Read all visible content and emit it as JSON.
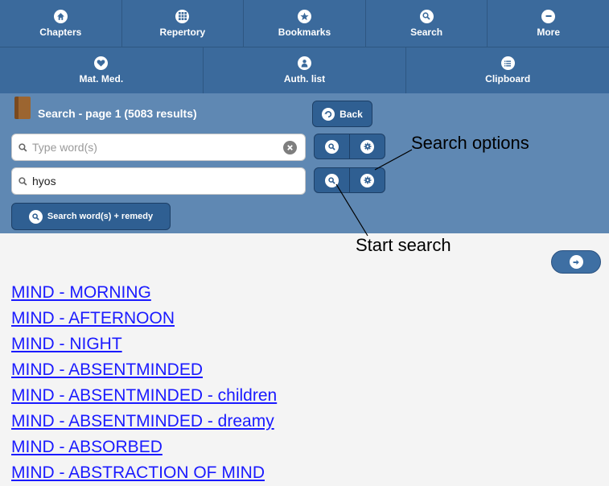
{
  "nav": {
    "row1": [
      {
        "label": "Chapters",
        "icon": "home-icon"
      },
      {
        "label": "Repertory",
        "icon": "grid-icon"
      },
      {
        "label": "Bookmarks",
        "icon": "star-icon"
      },
      {
        "label": "Search",
        "icon": "search-icon"
      },
      {
        "label": "More",
        "icon": "minus-icon"
      }
    ],
    "row2": [
      {
        "label": "Mat. Med.",
        "icon": "heart-icon"
      },
      {
        "label": "Auth. list",
        "icon": "person-icon"
      },
      {
        "label": "Clipboard",
        "icon": "list-icon"
      }
    ]
  },
  "search": {
    "title": "Search - page 1 (5083 results)",
    "back_label": "Back",
    "word_placeholder": "Type word(s)",
    "remedy_value": "hyos",
    "search_word_remedy_label": "Search word(s) + remedy"
  },
  "annotations": {
    "search_options": "Search options",
    "start_search": "Start search"
  },
  "results": [
    "MIND - MORNING",
    "MIND - AFTERNOON",
    "MIND - NIGHT",
    "MIND - ABSENTMINDED",
    "MIND - ABSENTMINDED - children",
    "MIND - ABSENTMINDED - dreamy",
    "MIND - ABSORBED",
    "MIND - ABSTRACTION OF MIND"
  ],
  "colors": {
    "nav_bg": "#3b6a9c",
    "panel_bg": "#5f88b3",
    "button_dark": "#2f5f92",
    "link": "#1a1aff"
  }
}
